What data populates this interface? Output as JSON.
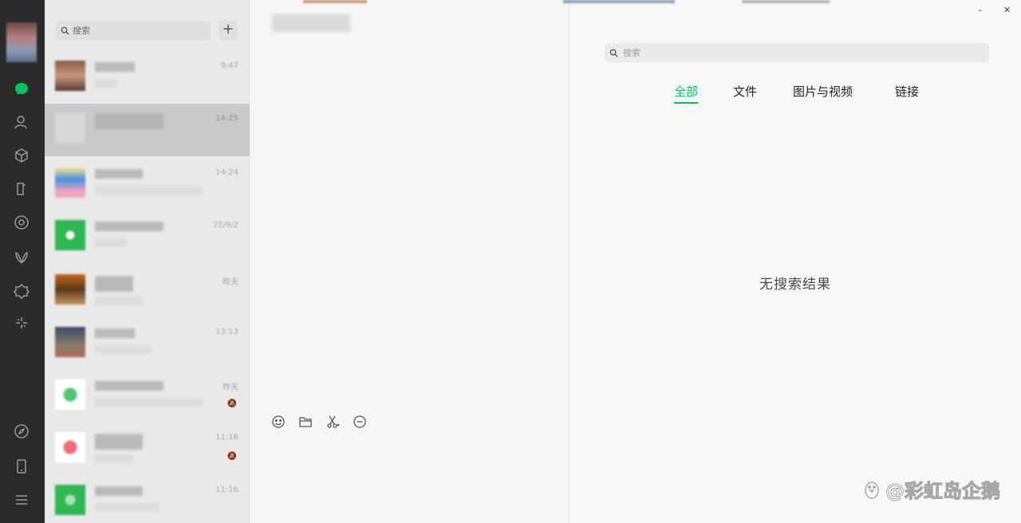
{
  "list": {
    "search_placeholder": "搜索",
    "add_label": "+",
    "items": [
      {
        "time": "9:47",
        "selected": false
      },
      {
        "time": "14:25",
        "selected": true
      },
      {
        "time": "14:24",
        "selected": false
      },
      {
        "time": "22/9/2",
        "selected": false
      },
      {
        "time": "昨天",
        "selected": false
      },
      {
        "time": "13:13",
        "selected": false
      },
      {
        "time": "昨天",
        "selected": false,
        "muted": true
      },
      {
        "time": "11:16",
        "selected": false,
        "muted": true
      },
      {
        "time": "11:16",
        "selected": false
      }
    ]
  },
  "pane": {
    "minimize_label": "–",
    "close_label": "✕",
    "search_placeholder": "搜索",
    "tabs": [
      {
        "label": "全部",
        "active": true
      },
      {
        "label": "文件",
        "active": false
      },
      {
        "label": "图片与视频",
        "active": false
      },
      {
        "label": "链接",
        "active": false
      }
    ],
    "empty_text": "无搜索结果",
    "watermark": "@彩虹岛企鹅"
  },
  "colors": {
    "accent": "#07c160",
    "rail": "#2b2b2b"
  }
}
